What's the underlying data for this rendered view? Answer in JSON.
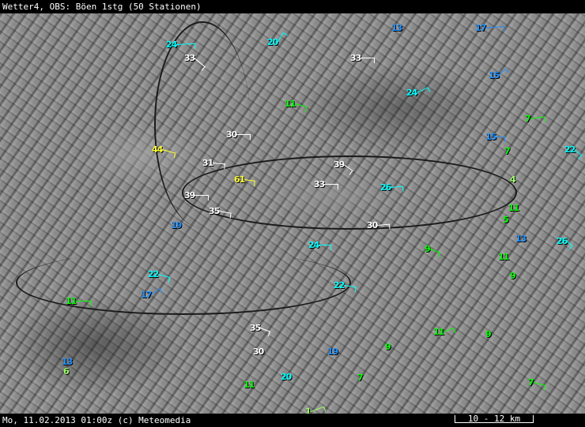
{
  "header": {
    "title": "Wetter4, OBS: Böen 1stg (50 Stationen)"
  },
  "footer": {
    "timestamp": "Mo, 11.02.2013 01:00z (c) Meteomedia",
    "scale": "10 - 12 km"
  },
  "colors": {
    "white": "#ffffff",
    "yellow": "#ffff33",
    "cyan": "#00ffff",
    "blue": "#1e90ff",
    "green": "#00ff00",
    "light_green": "#99ff66"
  },
  "stations": [
    {
      "value": "24"
    },
    {
      "value": "20"
    },
    {
      "value": "13"
    },
    {
      "value": "17"
    },
    {
      "value": "33"
    },
    {
      "value": "33"
    },
    {
      "value": "15"
    },
    {
      "value": "24"
    },
    {
      "value": "11"
    },
    {
      "value": "7"
    },
    {
      "value": "30"
    },
    {
      "value": "15"
    },
    {
      "value": "7"
    },
    {
      "value": "22"
    },
    {
      "value": "44"
    },
    {
      "value": "31"
    },
    {
      "value": "39"
    },
    {
      "value": "61"
    },
    {
      "value": "33"
    },
    {
      "value": "26"
    },
    {
      "value": "4"
    },
    {
      "value": "39"
    },
    {
      "value": "35"
    },
    {
      "value": "11"
    },
    {
      "value": "5"
    },
    {
      "value": "19"
    },
    {
      "value": "30"
    },
    {
      "value": "13"
    },
    {
      "value": "26"
    },
    {
      "value": "9"
    },
    {
      "value": "24"
    },
    {
      "value": "11"
    },
    {
      "value": "9"
    },
    {
      "value": "22"
    },
    {
      "value": "17"
    },
    {
      "value": "22"
    },
    {
      "value": "11"
    },
    {
      "value": "35"
    },
    {
      "value": "11"
    },
    {
      "value": "9"
    },
    {
      "value": "30"
    },
    {
      "value": "19"
    },
    {
      "value": "9"
    },
    {
      "value": "13"
    },
    {
      "value": "6"
    },
    {
      "value": "20"
    },
    {
      "value": "7"
    },
    {
      "value": "11"
    },
    {
      "value": "7"
    },
    {
      "value": "1"
    }
  ]
}
